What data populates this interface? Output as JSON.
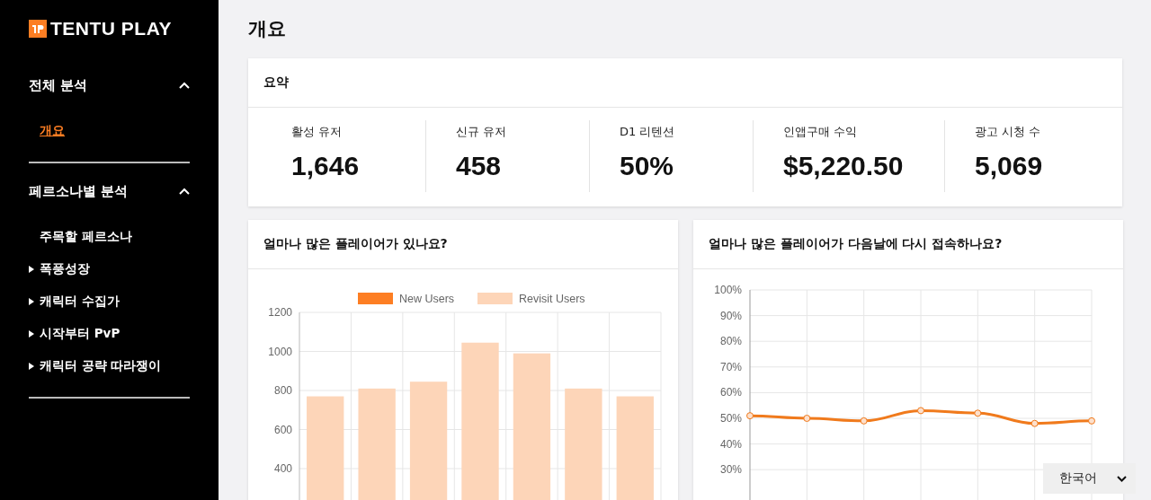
{
  "brand": {
    "name": "TENTU PLAY"
  },
  "sidebar": {
    "sections": [
      {
        "title": "전체 분석",
        "expanded": true,
        "items": [
          {
            "label": "개요",
            "kind": "link",
            "selected": true
          }
        ]
      },
      {
        "title": "페르소나별 분석",
        "expanded": true,
        "items": [
          {
            "label": "주목할 페르소나",
            "kind": "plain",
            "selected": false
          },
          {
            "label": "폭풍성장",
            "kind": "group",
            "expanded": false,
            "selected": false
          },
          {
            "label": "캐릭터 수집가",
            "kind": "group",
            "expanded": false,
            "selected": false
          },
          {
            "label": "시작부터 PvP",
            "kind": "group",
            "expanded": false,
            "selected": false
          },
          {
            "label": "캐릭터 공략 따라쟁이",
            "kind": "group",
            "expanded": false,
            "selected": false
          }
        ]
      }
    ]
  },
  "page": {
    "title": "개요"
  },
  "summary": {
    "title": "요약",
    "metrics": [
      {
        "label": "활성 유저",
        "value": "1,646"
      },
      {
        "label": "신규 유저",
        "value": "458"
      },
      {
        "label": "D1 리텐션",
        "value": "50%"
      },
      {
        "label": "인앱구매 수익",
        "value": "$5,220.50"
      },
      {
        "label": "광고 시청 수",
        "value": "5,069"
      }
    ]
  },
  "charts": [
    {
      "title": "얼마나 많은 플레이어가 있나요?",
      "chart_data": {
        "type": "bar",
        "series": [
          {
            "name": "New Users",
            "color": "#fd7e23",
            "values": [
              null,
              null,
              null,
              null,
              null,
              null,
              null
            ]
          },
          {
            "name": "Revisit Users",
            "color": "#fdd5b8",
            "values": [
              770,
              810,
              845,
              1045,
              990,
              810,
              770
            ]
          }
        ],
        "grid": true,
        "ylim": [
          0,
          1200
        ],
        "yticks": [
          400,
          600,
          800,
          1000,
          1200
        ]
      }
    },
    {
      "title": "얼마나 많은 플레이어가 다음날에 다시 접속하나요?",
      "chart_data": {
        "type": "line",
        "series": [
          {
            "color": "#f07a1c",
            "marker": true,
            "values": [
              51,
              50,
              49,
              53,
              52,
              48,
              49
            ]
          }
        ],
        "grid": true,
        "ylim": [
          0,
          100
        ],
        "yticks": [
          {
            "value": 30,
            "label": "30%"
          },
          {
            "value": 40,
            "label": "40%"
          },
          {
            "value": 50,
            "label": "50%"
          },
          {
            "value": 60,
            "label": "60%"
          },
          {
            "value": 70,
            "label": "70%"
          },
          {
            "value": 80,
            "label": "80%"
          },
          {
            "value": 90,
            "label": "90%"
          },
          {
            "value": 100,
            "label": "100%"
          }
        ]
      }
    }
  ],
  "language": {
    "value": "한국어"
  }
}
